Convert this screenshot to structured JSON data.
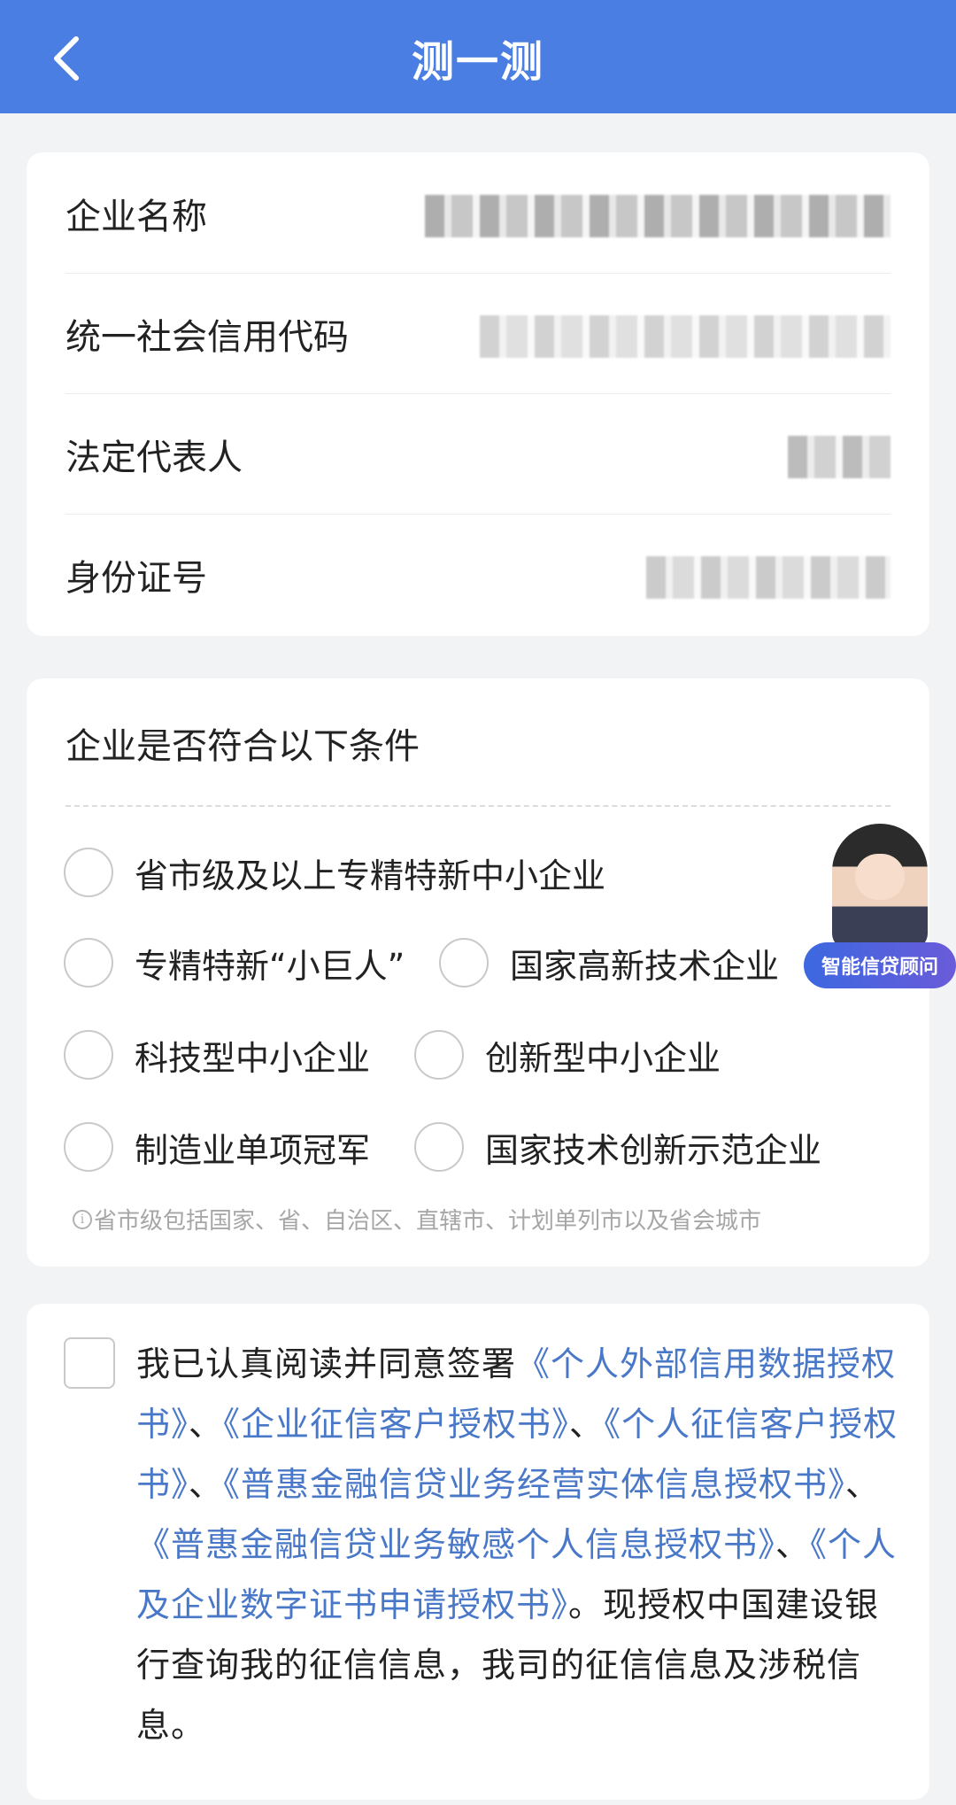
{
  "header": {
    "title": "测一测",
    "back_icon": "chevron-left-icon"
  },
  "company_info": {
    "rows": [
      {
        "label": "企业名称"
      },
      {
        "label": "统一社会信用代码"
      },
      {
        "label": "法定代表人"
      },
      {
        "label": "身份证号"
      }
    ]
  },
  "conditions": {
    "title": "企业是否符合以下条件",
    "options": [
      "省市级及以上专精特新中小企业",
      "专精特新“小巨人”",
      "国家高新技术企业",
      "科技型中小企业",
      "创新型中小企业",
      "制造业单项冠军",
      "国家技术创新示范企业"
    ],
    "hint": "省市级包括国家、省、自治区、直辖市、计划单列市以及省会城市"
  },
  "agreement": {
    "intro": "我已认真阅读并同意签署",
    "doc1": "《个人外部信用数据授权书》",
    "sep1": "、",
    "doc2": "《企业征信客户授权书》",
    "sep2": "、",
    "doc3": "《个人征信客户授权书》",
    "sep3": "、",
    "doc4": "《普惠金融信贷业务经营实体信息授权书》",
    "sep4": "、",
    "doc5": "《普惠金融信贷业务敏感个人信息授权书》",
    "sep5": "、",
    "doc6": "《个人及企业数字证书申请授权书》",
    "outro": "。现授权中国建设银行查询我的征信信息，我司的征信信息及涉税信息。"
  },
  "advisor": {
    "label": "智能信贷顾问"
  },
  "colors": {
    "header": "#4a7ee2",
    "link": "#4a78c8",
    "background": "#f2f3f5"
  }
}
